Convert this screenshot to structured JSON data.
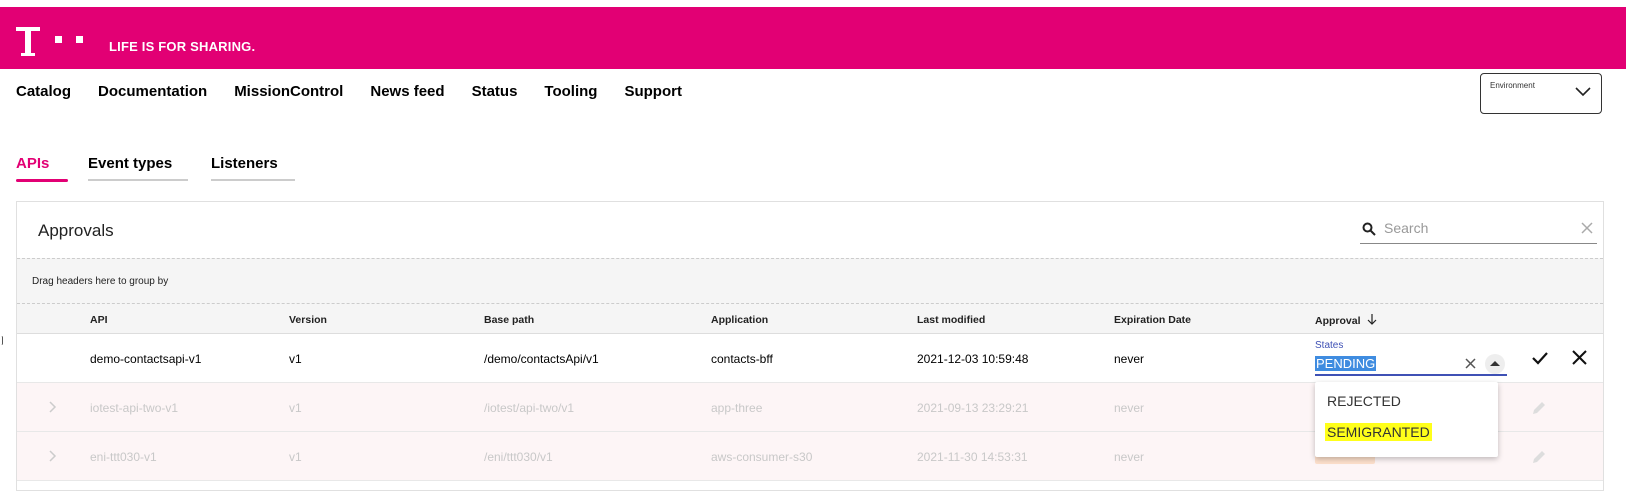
{
  "header": {
    "tagline": "LIFE IS FOR SHARING."
  },
  "brand_color": "#e20074",
  "nav": {
    "items": [
      "Catalog",
      "Documentation",
      "MissionControl",
      "News feed",
      "Status",
      "Tooling",
      "Support"
    ]
  },
  "environment": {
    "label": "Environment"
  },
  "tabs": [
    "APIs",
    "Event types",
    "Listeners"
  ],
  "card": {
    "title": "Approvals",
    "search_placeholder": "Search",
    "group_hint": "Drag headers here to group by"
  },
  "table": {
    "columns": [
      "API",
      "Version",
      "Base path",
      "Application",
      "Last modified",
      "Expiration Date",
      "Approval"
    ],
    "rows": [
      {
        "api": "demo-contactsapi-v1",
        "version": "v1",
        "base_path": "/demo/contactsApi/v1",
        "application": "contacts-bff",
        "last_modified": "2021-12-03 10:59:48",
        "expiration": "never"
      },
      {
        "api": "iotest-api-two-v1",
        "version": "v1",
        "base_path": "/iotest/api-two/v1",
        "application": "app-three",
        "last_modified": "2021-09-13 23:29:21",
        "expiration": "never"
      },
      {
        "api": "eni-ttt030-v1",
        "version": "v1",
        "base_path": "/eni/ttt030/v1",
        "application": "aws-consumer-s30",
        "last_modified": "2021-11-30 14:53:31",
        "expiration": "never"
      }
    ]
  },
  "approval_editor": {
    "label": "States",
    "value": "PENDING",
    "options": [
      "REJECTED",
      "SEMIGRANTED"
    ],
    "highlighted_option": "SEMIGRANTED"
  },
  "icons": {
    "sort": "arrow-down-icon",
    "confirm": "check-icon",
    "cancel": "close-icon",
    "expand": "chevron-right-icon",
    "edit": "pencil-icon"
  }
}
